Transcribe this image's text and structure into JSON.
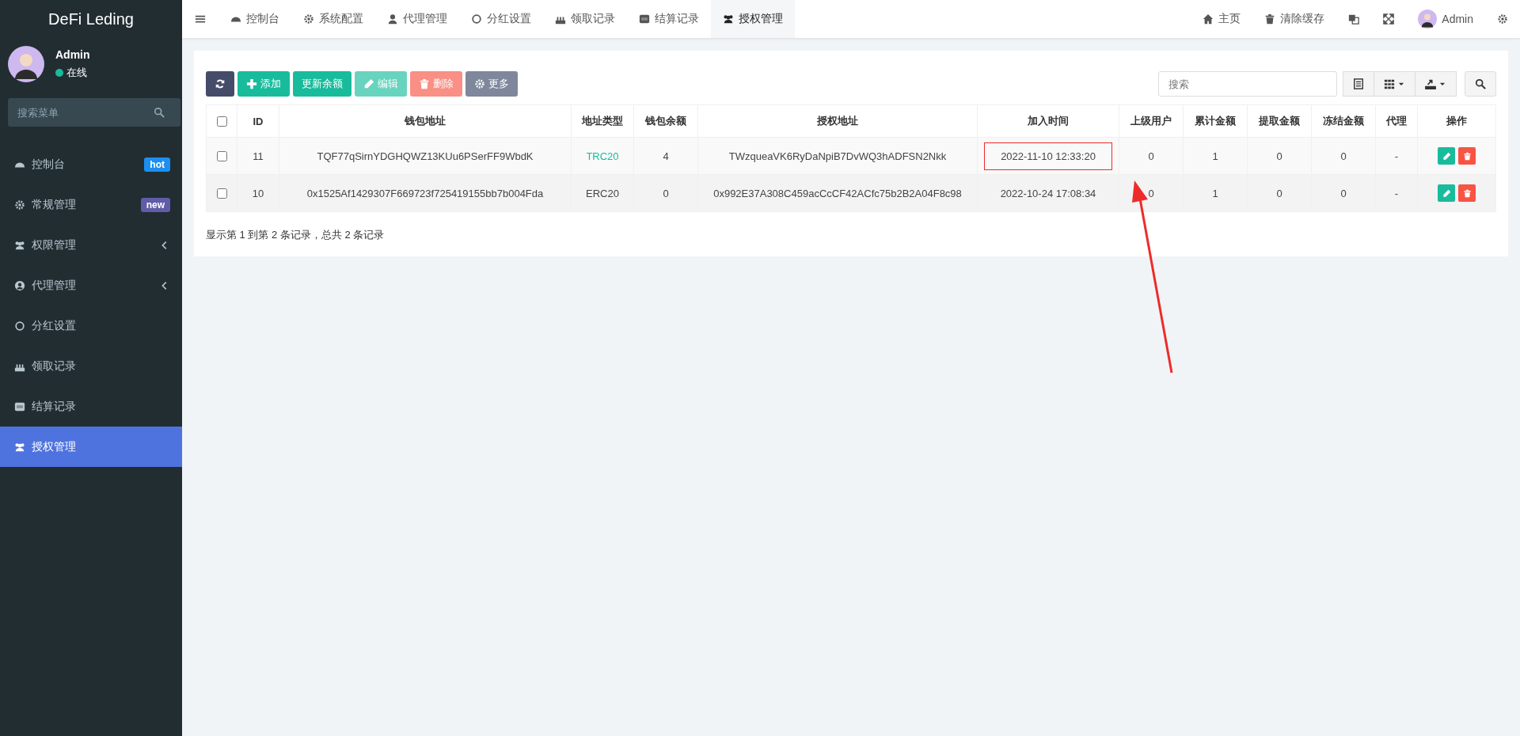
{
  "sidebar": {
    "logo": "DeFi Leding",
    "user": {
      "name": "Admin",
      "status": "在线",
      "online": true
    },
    "search": {
      "placeholder": "搜索菜单"
    },
    "items": [
      {
        "label": "控制台",
        "badge": {
          "text": "hot",
          "color": "#1c8ff0"
        },
        "expandable": false,
        "selected": false
      },
      {
        "label": "常规管理",
        "badge": {
          "text": "new",
          "color": "#605ca8"
        },
        "expandable": false,
        "selected": false
      },
      {
        "label": "权限管理",
        "expandable": true,
        "selected": false
      },
      {
        "label": "代理管理",
        "expandable": true,
        "selected": false
      },
      {
        "label": "分红设置",
        "expandable": false,
        "selected": false
      },
      {
        "label": "领取记录",
        "expandable": false,
        "selected": false
      },
      {
        "label": "结算记录",
        "expandable": false,
        "selected": false
      },
      {
        "label": "授权管理",
        "expandable": false,
        "selected": true
      }
    ]
  },
  "tabs": [
    {
      "label": "控制台",
      "selected": false
    },
    {
      "label": "系统配置",
      "selected": false
    },
    {
      "label": "代理管理",
      "selected": false
    },
    {
      "label": "分红设置",
      "selected": false
    },
    {
      "label": "领取记录",
      "selected": false
    },
    {
      "label": "结算记录",
      "selected": false
    },
    {
      "label": "授权管理",
      "selected": true
    }
  ],
  "topbar": {
    "home": "主页",
    "clear_cache": "清除缓存",
    "user": "Admin"
  },
  "toolbar": {
    "buttons": [
      {
        "disabled": false
      },
      {
        "label": "添加",
        "disabled": false
      },
      {
        "label": "更新余额",
        "disabled": false
      },
      {
        "label": "编辑",
        "disabled": true
      },
      {
        "label": "删除",
        "disabled": true
      },
      {
        "label": "更多",
        "disabled": false
      }
    ],
    "search": {
      "placeholder": "搜索"
    }
  },
  "table": {
    "select_all_checked": false,
    "columns": [
      "ID",
      "钱包地址",
      "地址类型",
      "钱包余额",
      "授权地址",
      "加入时间",
      "上级用户",
      "累计金额",
      "提取金额",
      "冻结金额",
      "代理",
      "操作"
    ],
    "rows": [
      {
        "checked": false,
        "cells": [
          "11",
          "TQF77qSirnYDGHQWZ13KUu6PSerFF9WbdK",
          "TRC20",
          "4",
          "TWzqueaVK6RyDaNpiB7DvWQ3hADFSN2Nkk",
          "2022-11-10 12:33:20",
          "0",
          "1",
          "0",
          "0",
          "-"
        ],
        "color": "#18bc9c",
        "highlighted": true
      },
      {
        "checked": false,
        "cells": [
          "10",
          "0x1525Af1429307F669723f725419155bb7b004Fda",
          "ERC20",
          "0",
          "0x992E37A308C459acCcCF42ACfc75b2B2A04F8c98",
          "2022-10-24 17:08:34",
          "0",
          "1",
          "0",
          "0",
          "-"
        ],
        "color": "#444444",
        "highlighted": false
      }
    ]
  },
  "summary": "显示第 1 到第 2 条记录，总共 2 条记录"
}
